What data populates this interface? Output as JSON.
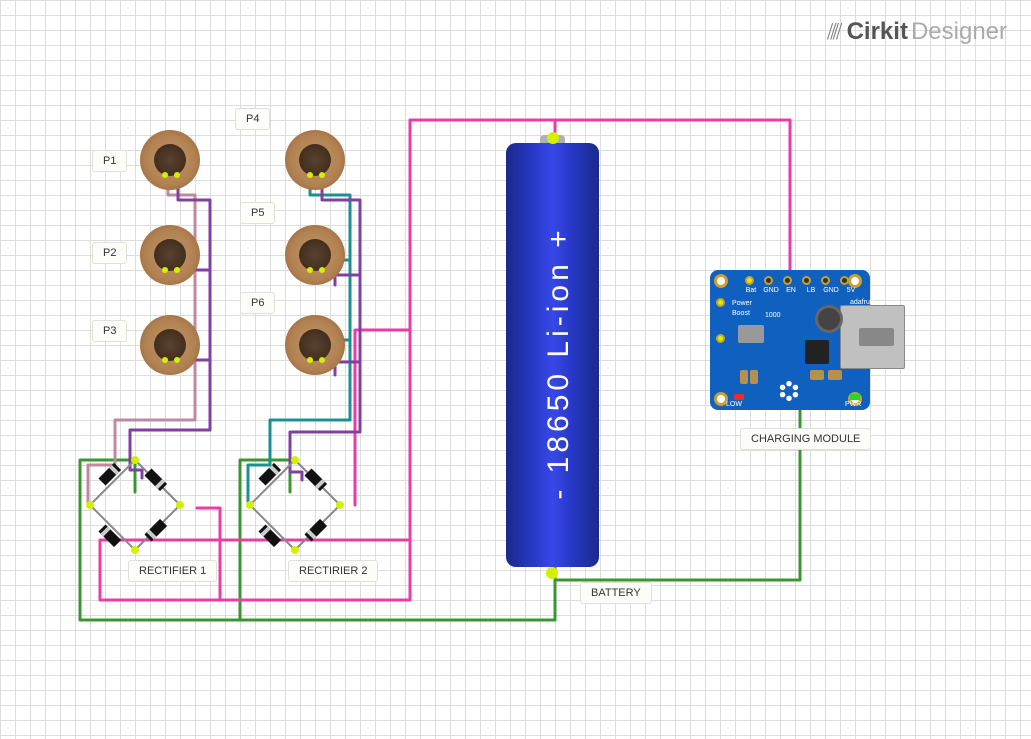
{
  "logo": {
    "icon": "⫽⫽",
    "brand": "Cirkit",
    "product": "Designer"
  },
  "labels": {
    "p1": "P1",
    "p2": "P2",
    "p3": "P3",
    "p4": "P4",
    "p5": "P5",
    "p6": "P6",
    "rect1": "RECTIFIER 1",
    "rect2": "RECTIRIER 2",
    "battery": "BATTERY",
    "charging": "CHARGING MODULE"
  },
  "battery": {
    "text": "- 18650 Li-ion +"
  },
  "module": {
    "pins": [
      "Bat",
      "GND",
      "EN",
      "LB",
      "GND",
      "5V"
    ],
    "boardtext1": "Power",
    "boardtext2": "Boost",
    "boardtext3": "1000",
    "low": "LOW",
    "pwr": "PWR",
    "adafruit": "adafruit"
  },
  "wire_colors": {
    "pink": "#e83ca8",
    "green": "#3a9630",
    "teal": "#1a9090",
    "rose": "#c088a0",
    "purple": "#8040a0"
  }
}
